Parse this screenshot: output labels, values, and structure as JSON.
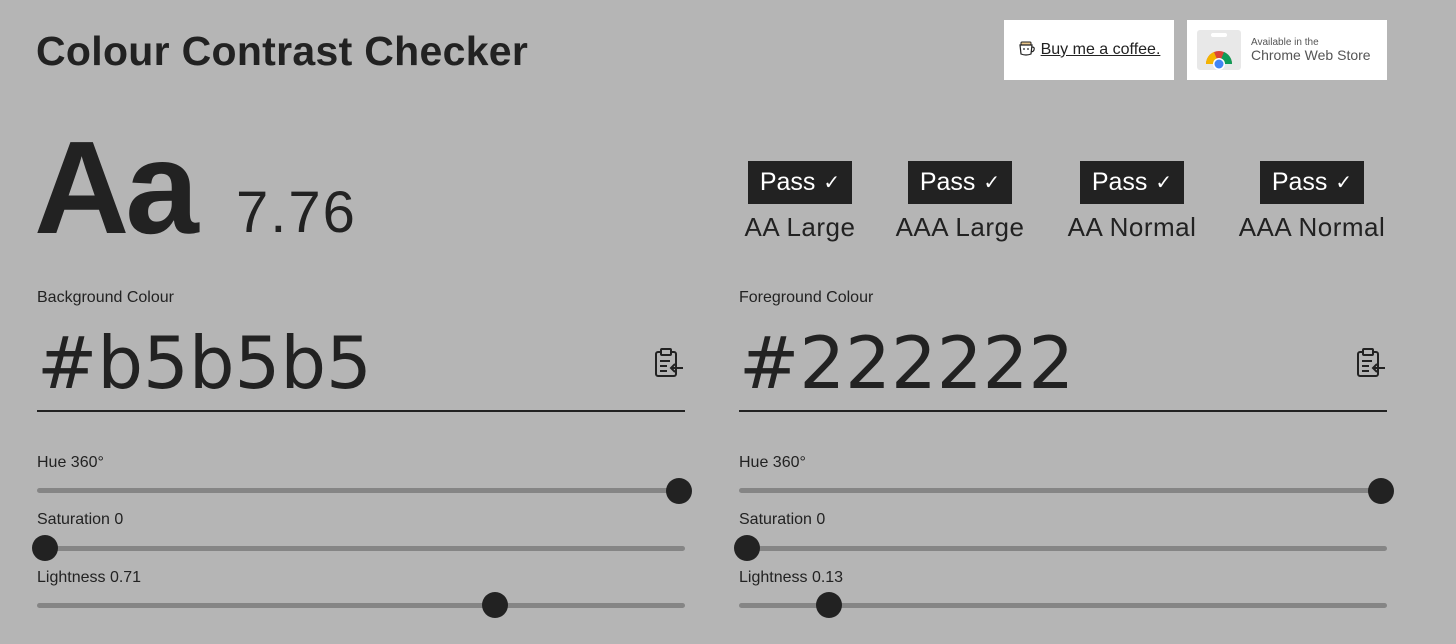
{
  "header": {
    "title": "Colour Contrast Checker",
    "coffee_label": "Buy me a coffee.",
    "store_small": "Available in the",
    "store_big": "Chrome Web Store"
  },
  "preview": {
    "sample_text": "Aa",
    "ratio": "7.76"
  },
  "results": [
    {
      "badge": "Pass",
      "label": "AA Large"
    },
    {
      "badge": "Pass",
      "label": "AAA Large"
    },
    {
      "badge": "Pass",
      "label": "AA Normal"
    },
    {
      "badge": "Pass",
      "label": "AAA Normal"
    }
  ],
  "background": {
    "label": "Background Colour",
    "value": "#b5b5b5",
    "hue_label": "Hue 360°",
    "saturation_label": "Saturation 0",
    "lightness_label": "Lightness 0.71",
    "hue": 360,
    "saturation": 0,
    "lightness": 0.71
  },
  "foreground": {
    "label": "Foreground Colour",
    "value": "#222222",
    "hue_label": "Hue 360°",
    "saturation_label": "Saturation 0",
    "lightness_label": "Lightness 0.13",
    "hue": 360,
    "saturation": 0,
    "lightness": 0.13
  },
  "colors": {
    "page_background": "#b5b5b5",
    "text": "#222222",
    "track": "#858585"
  },
  "icons": {
    "check": "check-icon",
    "paste": "clipboard-paste-icon",
    "coffee": "coffee-cup-icon",
    "chrome": "chrome-logo-icon"
  }
}
